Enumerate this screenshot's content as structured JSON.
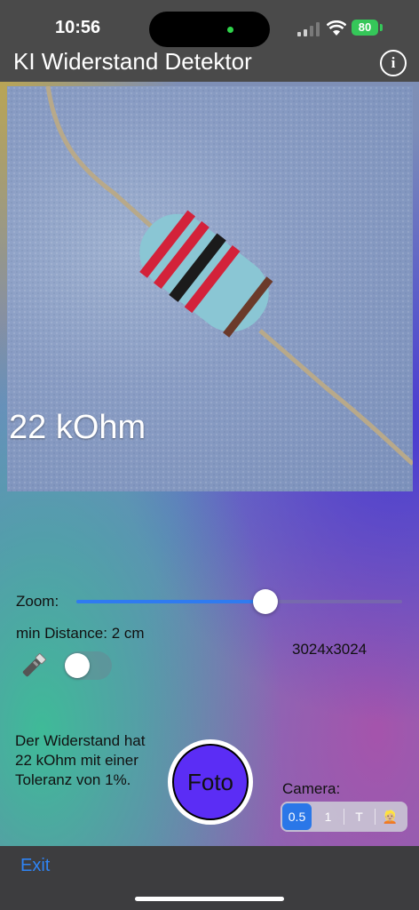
{
  "status_bar": {
    "time": "10:56",
    "battery": "80"
  },
  "header": {
    "title": "KI Widerstand Detektor",
    "info_icon": "info-icon"
  },
  "photo": {
    "result_label": "22 kOhm"
  },
  "controls": {
    "zoom_label": "Zoom:",
    "zoom_level": 0.58,
    "min_distance": "min Distance: 2 cm",
    "resolution": "3024x3024",
    "flashlight_icon": "flashlight-icon",
    "flashlight_on": false
  },
  "description": "Der Widerstand hat 22 kOhm mit einer Toleranz von 1%.",
  "capture": {
    "button_label": "Foto"
  },
  "camera": {
    "label": "Camera:",
    "options": [
      "0.5",
      "1",
      "T",
      "👱🏼"
    ],
    "selected": "0.5"
  },
  "footer": {
    "exit_label": "Exit"
  },
  "colors": {
    "accent": "#2f7bf0",
    "foto_button": "#5b2df5",
    "exit": "#2f84f5"
  }
}
